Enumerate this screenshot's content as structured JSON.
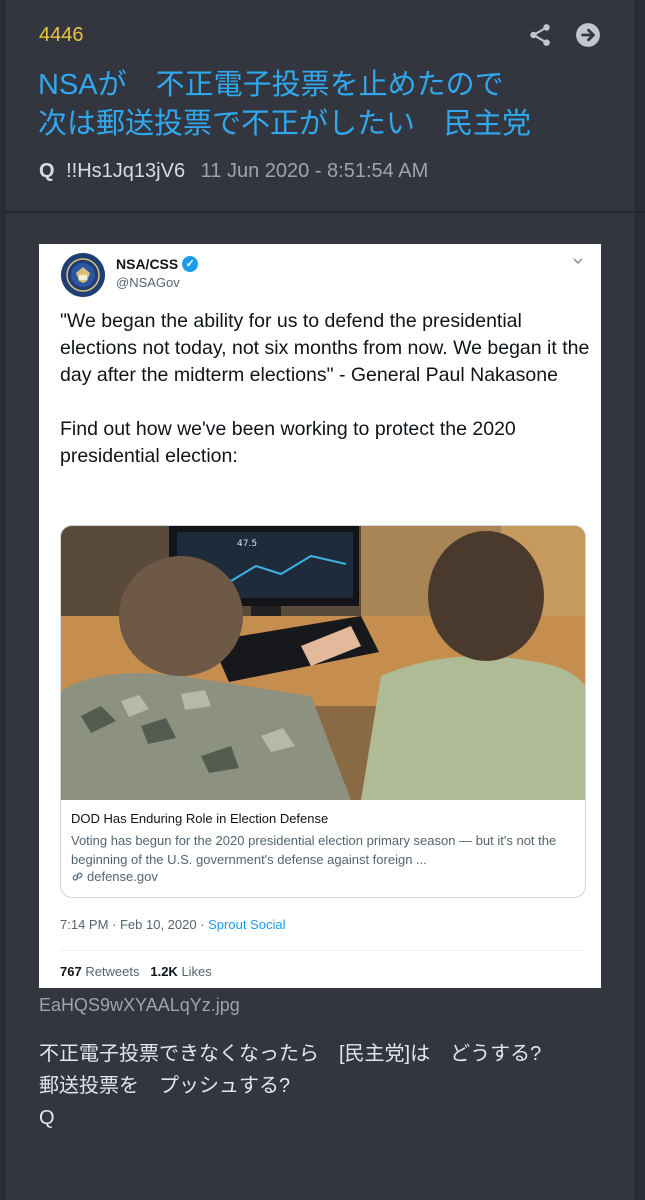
{
  "post": {
    "number": "4446",
    "title": "NSAが　不正電子投票を止めたので\n次は郵送投票で不正がしたい　民主党",
    "author": "Q",
    "tripcode": "!!Hs1Jq13jV6",
    "timestamp": "11 Jun 2020 - 8:51:54 AM",
    "filename": "EaHQS9wXYAALqYz.jpg",
    "body": "不正電子投票できなくなったら　[民主党]は　どうする?\n郵送投票を　プッシュする?\nQ",
    "icons": [
      "share-icon",
      "arrow-circle-right-icon"
    ]
  },
  "tweet": {
    "name": "NSA/CSS",
    "handle": "@NSAGov",
    "text": "\"We began the ability for us to defend the presidential elections not today, not six months from now. We began it the day after the midterm elections\" - General Paul Nakasone\n\nFind out how we've been working to protect the 2020 presidential election:",
    "card": {
      "title": "DOD Has Enduring Role in Election Defense",
      "description": "Voting has begun for the 2020 presidential election primary season — but it's not the beginning of the U.S. government's defense against foreign ...",
      "domain": "defense.gov",
      "monitor_value": "47.5"
    },
    "time": "7:14 PM · Feb 10, 2020 · ",
    "source": "Sprout Social",
    "retweets": "767",
    "retweets_label": " Retweets",
    "likes": "1.2K",
    "likes_label": " Likes"
  },
  "colors": {
    "background": "#33363f",
    "accent_title": "#31a8ee",
    "post_number": "#e8c53a",
    "link_blue": "#1d9bf0"
  }
}
